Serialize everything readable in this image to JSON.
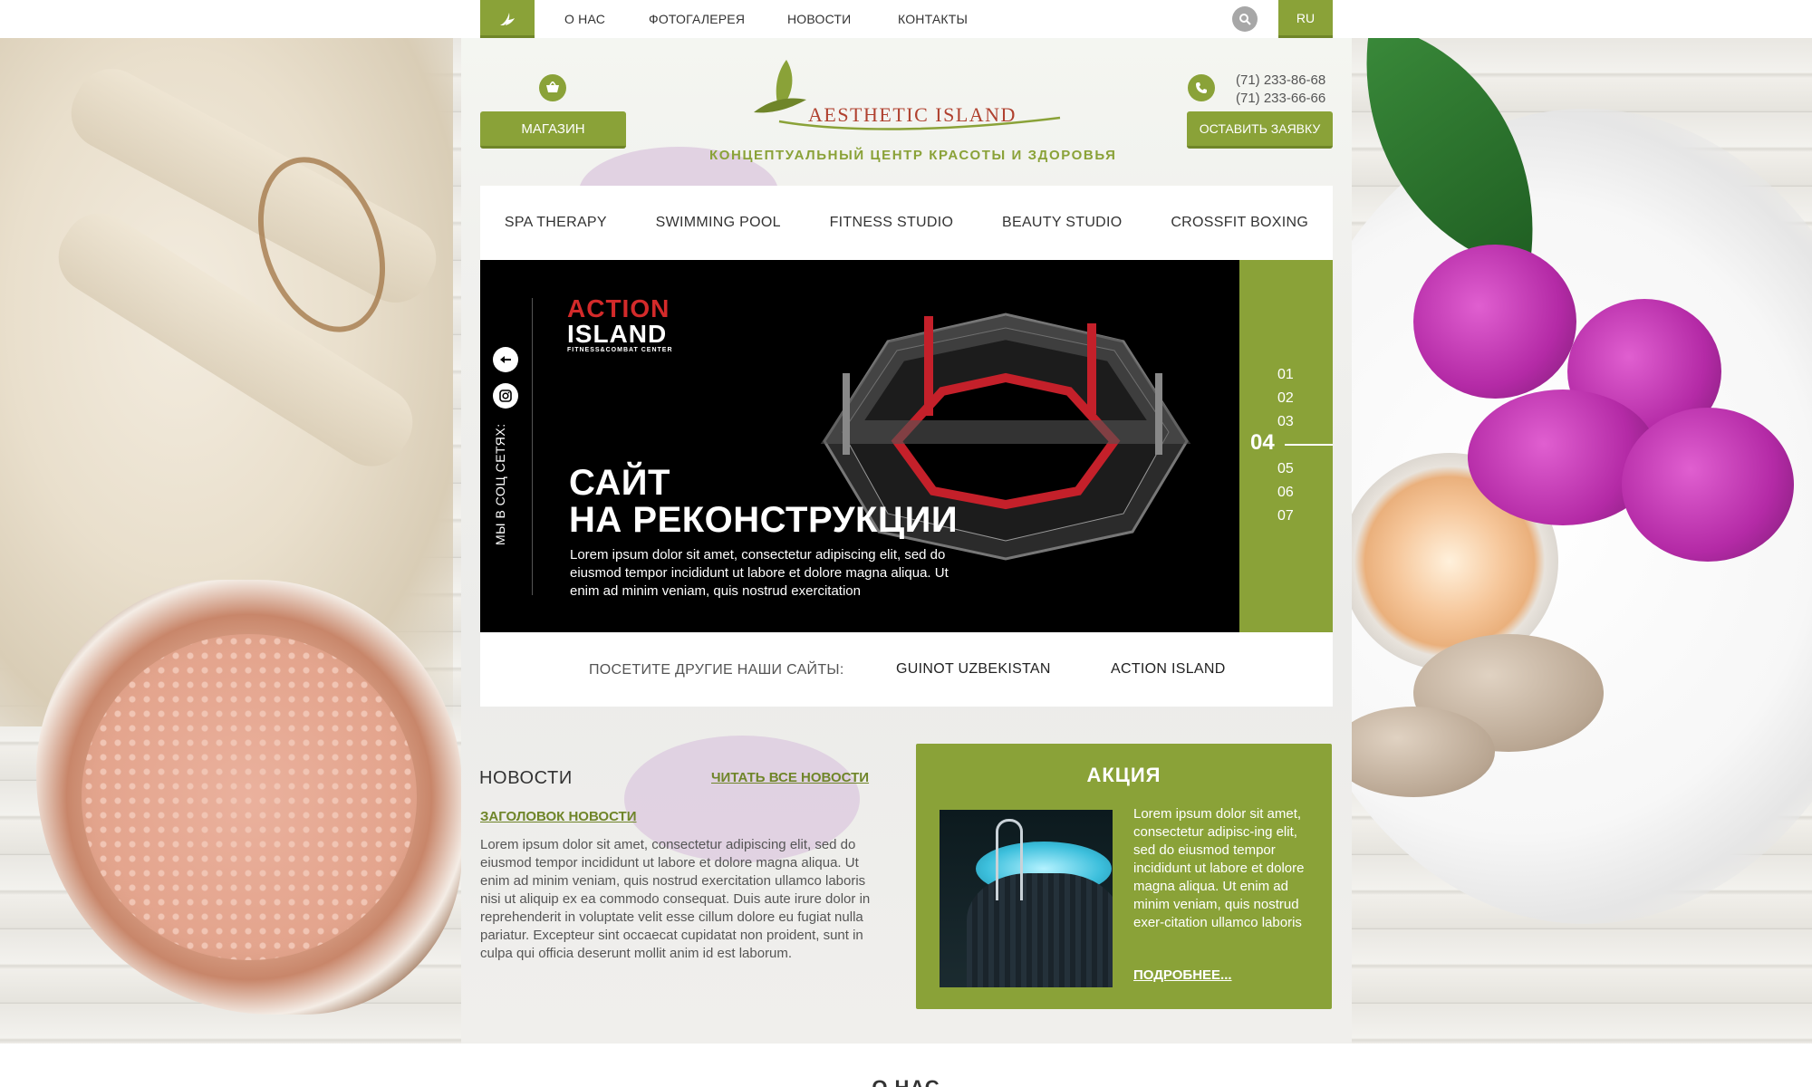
{
  "colors": {
    "accent": "#8aa238",
    "accent_dark": "#6f8529",
    "brand_red": "#b0412f",
    "slider_bg": "#000000"
  },
  "topnav": {
    "items": [
      "О НАС",
      "ФОТОГАЛЕРЕЯ",
      "НОВОСТИ",
      "КОНТАКТЫ"
    ],
    "lang": "RU",
    "logo_icon": "leaf-logo-icon",
    "search_icon": "search-icon"
  },
  "header": {
    "shop_label": "МАГАЗИН",
    "shop_icon": "basket-icon",
    "brand_name": "AESTHETIC ISLAND",
    "tagline": "КОНЦЕПТУАЛЬНЫЙ ЦЕНТР КРАСОТЫ И ЗДОРОВЬЯ",
    "phones": [
      "(71) 233-86-68",
      "(71) 233-66-66"
    ],
    "phone_icon": "phone-icon",
    "request_label": "ОСТАВИТЬ ЗАЯВКУ"
  },
  "services": [
    "SPA THERAPY",
    "SWIMMING POOL",
    "FITNESS STUDIO",
    "BEAUTY STUDIO",
    "CROSSFIT BOXING"
  ],
  "slider": {
    "social_label": "МЫ В СОЦ СЕТЯХ:",
    "logo_line1": "ACTION",
    "logo_line2": "ISLAND",
    "logo_sub": "FITNESS&COMBAT CENTER",
    "title_line1": "САЙТ",
    "title_line2": "НА РЕКОНСТРУКЦИИ",
    "text": "Lorem ipsum dolor sit amet, consectetur adipiscing elit, sed do eiusmod tempor incididunt ut labore et dolore magna aliqua. Ut enim ad minim veniam, quis nostrud exercitation",
    "pages": [
      "01",
      "02",
      "03",
      "05",
      "06",
      "07"
    ],
    "active_page": "04"
  },
  "other_sites": {
    "label": "ПОСЕТИТЕ ДРУГИЕ НАШИ САЙТЫ:",
    "links": [
      "GUINOT UZBEKISTAN",
      "ACTION ISLAND"
    ]
  },
  "news": {
    "title": "НОВОСТИ",
    "all_link": "ЧИТАТЬ ВСЕ НОВОСТИ",
    "heading": "ЗАГОЛОВОК НОВОСТИ",
    "text": "Lorem ipsum dolor sit amet, consectetur adipiscing elit, sed do eiusmod tempor incididunt ut labore et dolore magna aliqua. Ut enim ad minim veniam, quis nostrud exercitation ullamco laboris nisi ut aliquip ex ea commodo consequat. Duis aute irure dolor in reprehenderit in voluptate velit esse cillum dolore eu fugiat nulla pariatur. Excepteur sint occaecat cupidatat non proident, sunt in culpa qui officia deserunt mollit anim id est laborum."
  },
  "promo": {
    "title": "АКЦИЯ",
    "text": "Lorem ipsum dolor sit amet, consectetur adipisc-ing elit, sed do eiusmod tempor incididunt ut labore et dolore magna aliqua. Ut enim ad minim veniam, quis nostrud exer-citation ullamco laboris",
    "more_link": "ПОДРОБНЕЕ..."
  },
  "about": {
    "title": "О НАС"
  }
}
